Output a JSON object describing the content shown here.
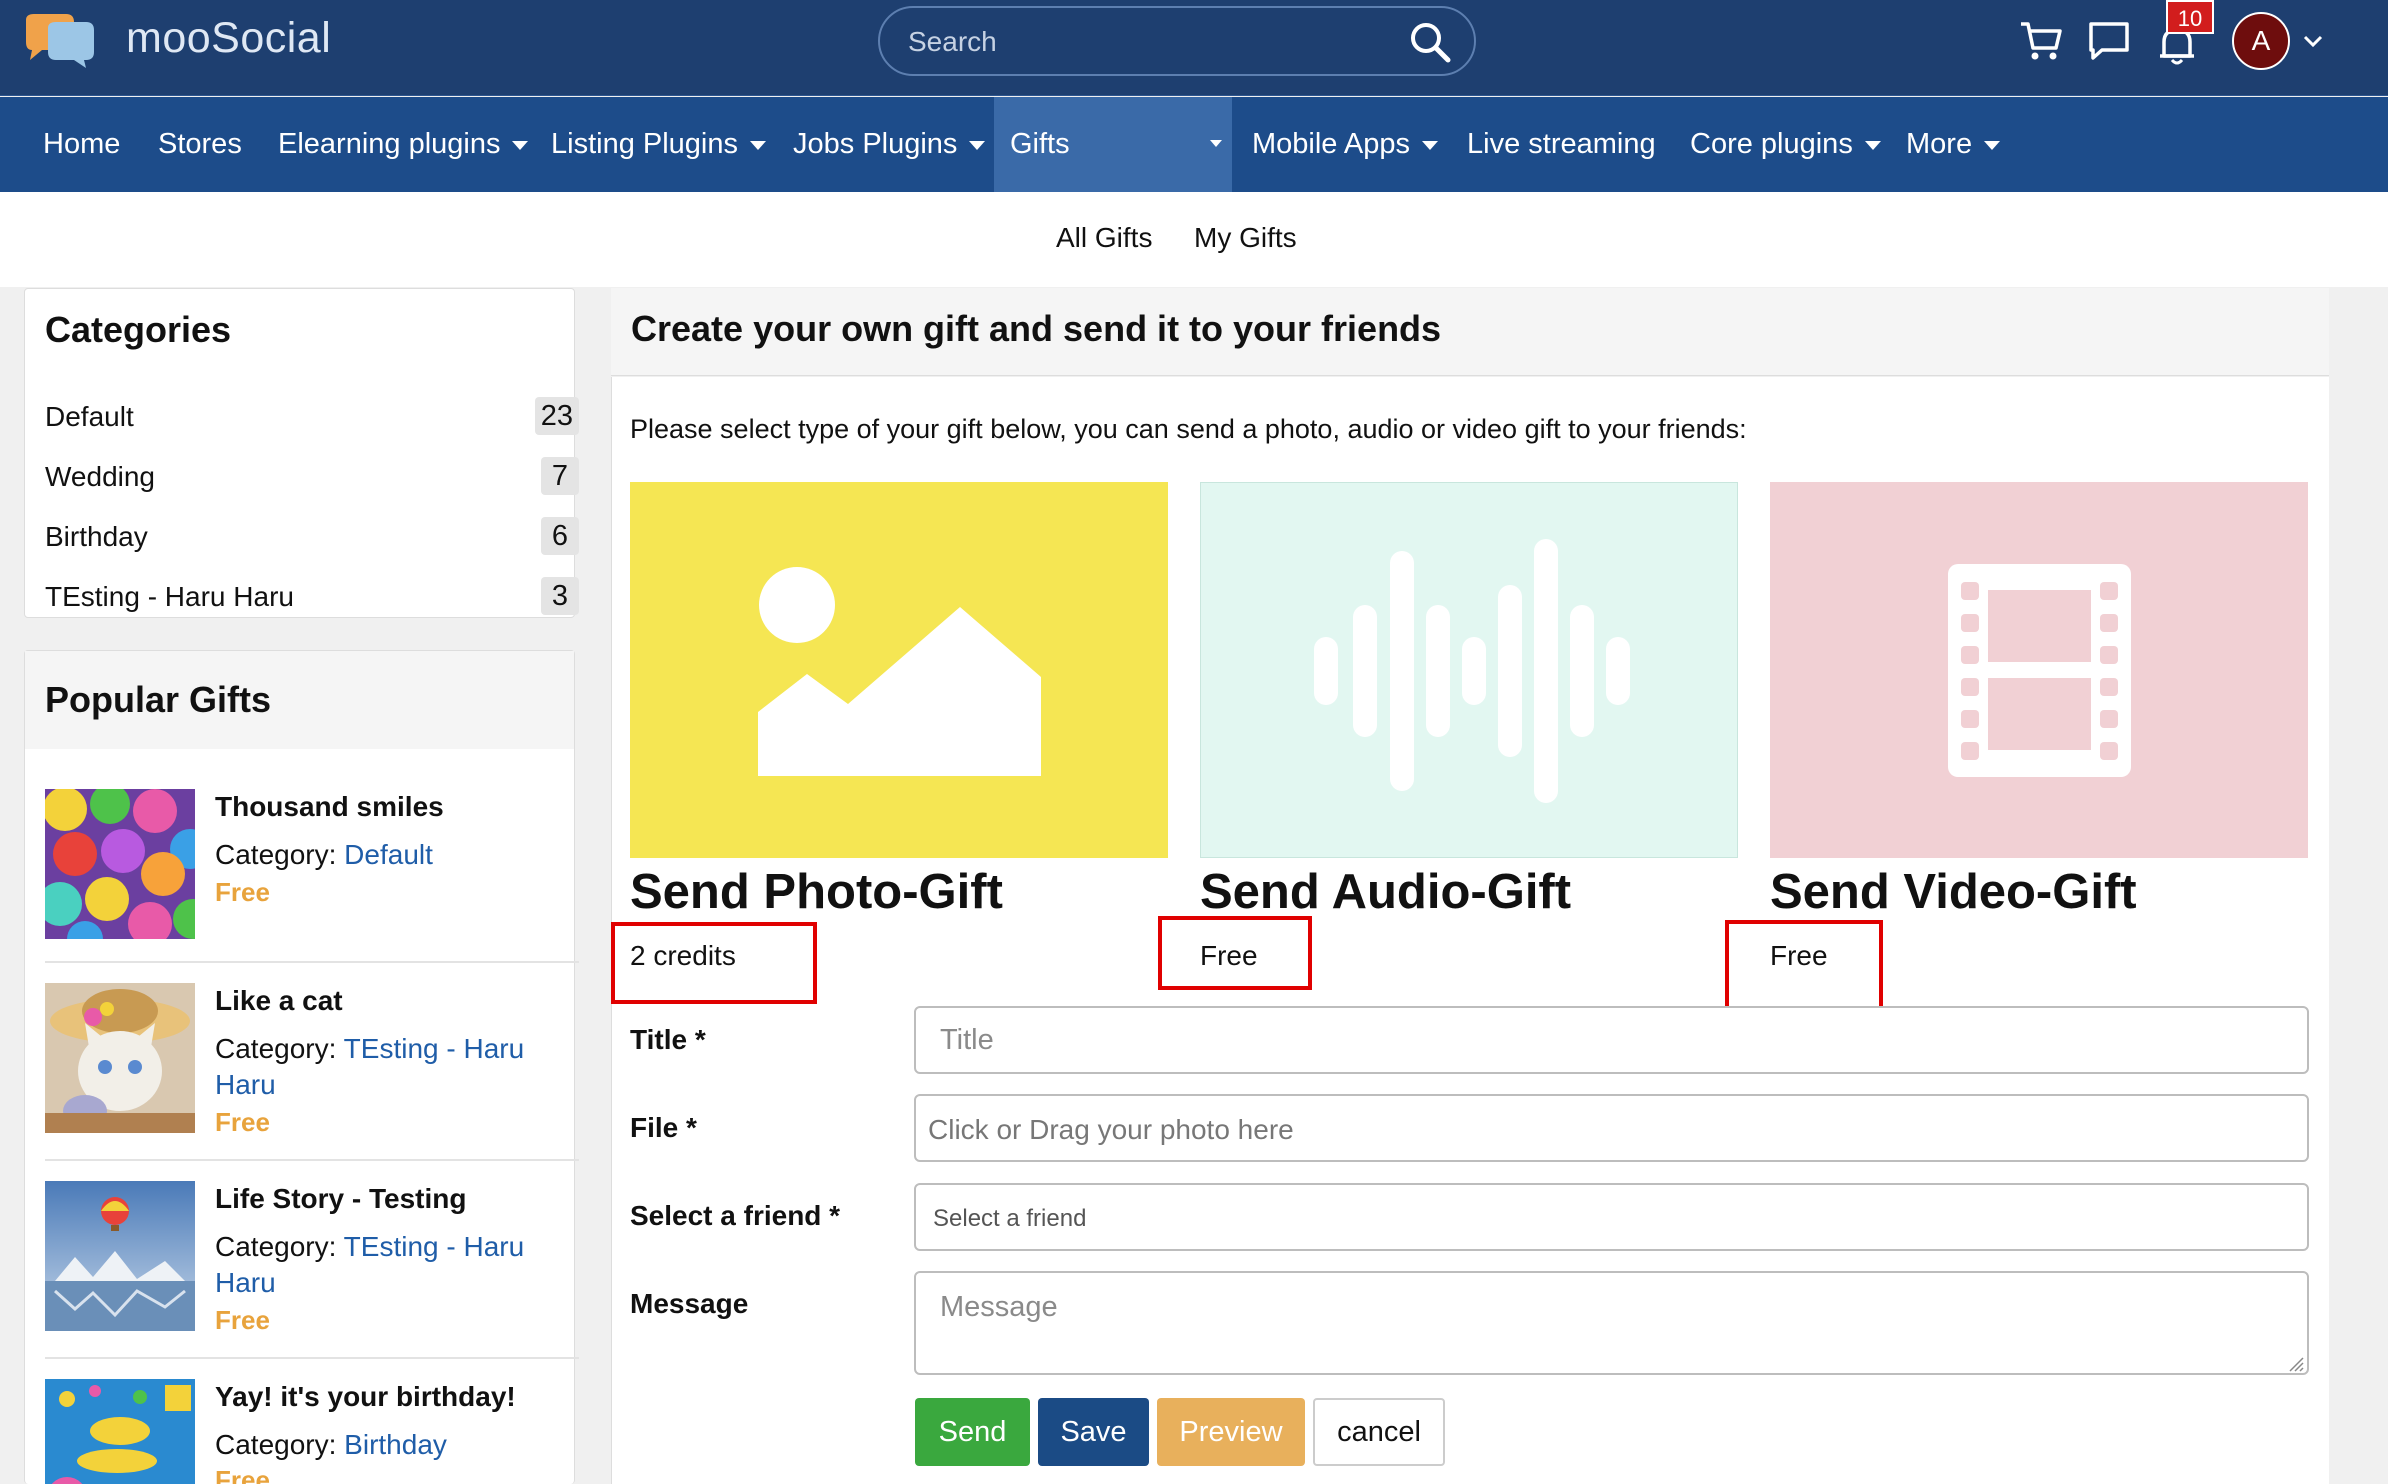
{
  "header": {
    "brand": "mooSocial",
    "search_placeholder": "Search",
    "notification_count": "10",
    "avatar_initial": "A"
  },
  "nav": {
    "items": [
      {
        "label": "Home",
        "dropdown": false
      },
      {
        "label": "Stores",
        "dropdown": false
      },
      {
        "label": "Elearning plugins",
        "dropdown": true
      },
      {
        "label": "Listing Plugins",
        "dropdown": true
      },
      {
        "label": "Jobs Plugins",
        "dropdown": true
      },
      {
        "label": "Gifts",
        "dropdown": true,
        "active": true
      },
      {
        "label": "Mobile Apps",
        "dropdown": true
      },
      {
        "label": "Live streaming",
        "dropdown": false
      },
      {
        "label": "Core plugins",
        "dropdown": true
      },
      {
        "label": "More",
        "dropdown": true
      }
    ]
  },
  "subnav": {
    "items": [
      "All Gifts",
      "My Gifts"
    ]
  },
  "categories": {
    "title": "Categories",
    "items": [
      {
        "name": "Default",
        "count": "23"
      },
      {
        "name": "Wedding",
        "count": "7"
      },
      {
        "name": "Birthday",
        "count": "6"
      },
      {
        "name": "TEsting - Haru Haru",
        "count": "3"
      }
    ]
  },
  "popular": {
    "title": "Popular Gifts",
    "category_prefix": "Category: ",
    "items": [
      {
        "name": "Thousand smiles",
        "category": "Default",
        "price": "Free"
      },
      {
        "name": "Like a cat",
        "category": "TEsting - Haru Haru",
        "price": "Free"
      },
      {
        "name": "Life Story - Testing",
        "category": "TEsting - Haru Haru",
        "price": "Free"
      },
      {
        "name": "Yay! it's your birthday!",
        "category": "Birthday",
        "price": "Free"
      }
    ]
  },
  "main": {
    "heading": "Create your own gift and send it to your friends",
    "intro": "Please select type of your gift below, you can send a photo, audio or video gift to your friends:",
    "cards": [
      {
        "title": "Send Photo-Gift",
        "price": "2 credits",
        "color": "#f5e653",
        "icon": "image-icon"
      },
      {
        "title": "Send Audio-Gift",
        "price": "Free",
        "color": "#e2f7f1",
        "icon": "audio-wave-icon"
      },
      {
        "title": "Send Video-Gift",
        "price": "Free",
        "color": "#f1d0d4",
        "icon": "film-icon"
      }
    ]
  },
  "form": {
    "title_label": "Title *",
    "title_placeholder": "Title",
    "file_label": "File *",
    "file_placeholder": "Click or Drag your photo here",
    "friend_label": "Select a friend *",
    "friend_placeholder": "Select a friend",
    "message_label": "Message",
    "message_placeholder": "Message",
    "buttons": {
      "send": "Send",
      "save": "Save",
      "preview": "Preview",
      "cancel": "cancel"
    }
  },
  "colors": {
    "header": "#1e3f70",
    "nav": "#1d4c8a",
    "nav_active": "#3a6aa8",
    "link": "#1f5da8",
    "price": "#e8a33c",
    "highlight_box": "#e00000"
  }
}
